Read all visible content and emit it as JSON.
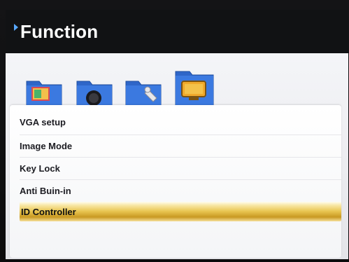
{
  "header": {
    "title": "Function"
  },
  "toolbar": {
    "icons": [
      {
        "name": "picture-folder-icon"
      },
      {
        "name": "display-folder-icon"
      },
      {
        "name": "tools-folder-icon"
      },
      {
        "name": "function-folder-icon",
        "selected": true
      }
    ]
  },
  "menu": {
    "items": [
      {
        "label": "VGA setup"
      },
      {
        "label": "Image Mode"
      },
      {
        "label": "Key Lock"
      },
      {
        "label": "Anti Buin-in"
      },
      {
        "label": "ID Controller",
        "selected": true
      }
    ]
  },
  "colors": {
    "title_bg": "#111214",
    "panel_bg": "#f1f2f5",
    "folder_blue": "#2f66c8",
    "highlight_gold": "#e2b640"
  }
}
